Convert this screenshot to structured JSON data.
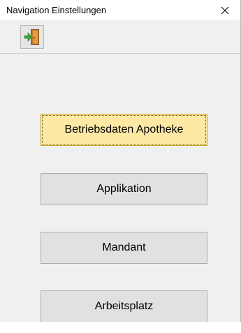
{
  "window": {
    "title": "Navigation Einstellungen",
    "close_icon": "close-icon"
  },
  "toolbar": {
    "exit_icon": "exit-door-icon"
  },
  "nav": {
    "buttons": [
      {
        "label": "Betriebsdaten Apotheke",
        "state": "selected"
      },
      {
        "label": "Applikation"
      },
      {
        "label": "Mandant"
      },
      {
        "label": "Arbeitsplatz"
      }
    ]
  },
  "colors": {
    "selected_button_bg": "#fde8a4",
    "button_bg": "#e1e1e1",
    "window_bg": "#f0f0f0"
  }
}
